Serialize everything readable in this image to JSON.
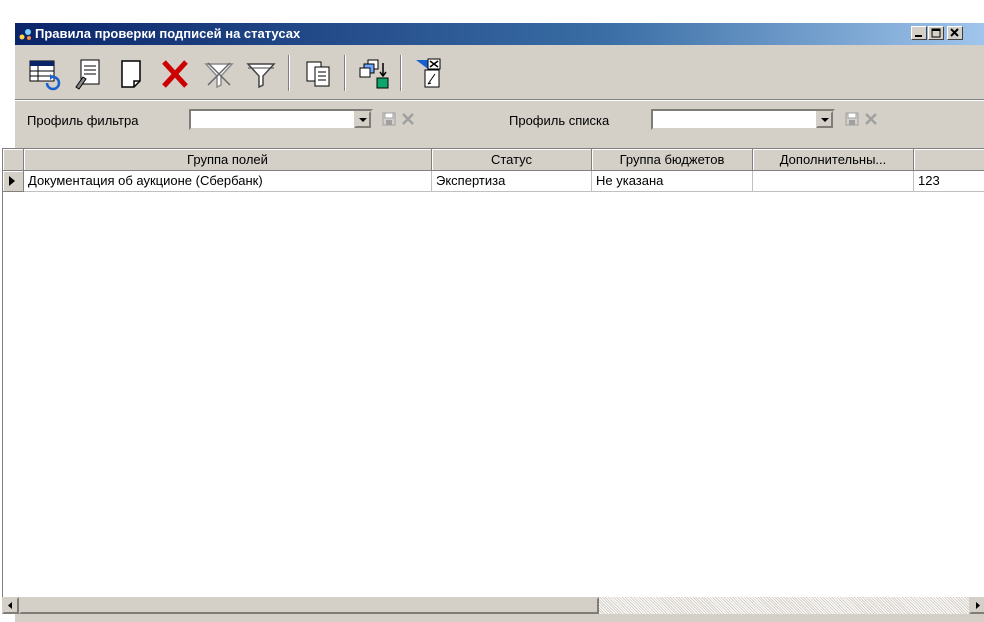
{
  "window": {
    "title": "Правила проверки подписей на статусах"
  },
  "toolbar": {
    "buttons": [
      {
        "name": "refresh-icon"
      },
      {
        "name": "edit-document-icon"
      },
      {
        "name": "new-document-icon"
      },
      {
        "name": "delete-icon"
      },
      {
        "name": "clear-filter-icon"
      },
      {
        "name": "filter-icon"
      },
      {
        "name": "copy-icon"
      },
      {
        "name": "export-icon"
      },
      {
        "name": "filter-settings-icon"
      }
    ]
  },
  "filters": {
    "filter_profile_label": "Профиль фильтра",
    "filter_profile_value": "",
    "list_profile_label": "Профиль списка",
    "list_profile_value": ""
  },
  "table": {
    "columns": [
      "Группа полей",
      "Статус",
      "Группа бюджетов",
      "Дополнительны...",
      ""
    ],
    "rows": [
      [
        "Документация об аукционе (Сбербанк)",
        "Экспертиза",
        "Не указана",
        "",
        "123"
      ]
    ]
  },
  "colors": {
    "title_gradient_start": "#0a246a",
    "title_gradient_end": "#a6caf0",
    "face": "#d4d0c8",
    "delete_red": "#cc0000"
  }
}
